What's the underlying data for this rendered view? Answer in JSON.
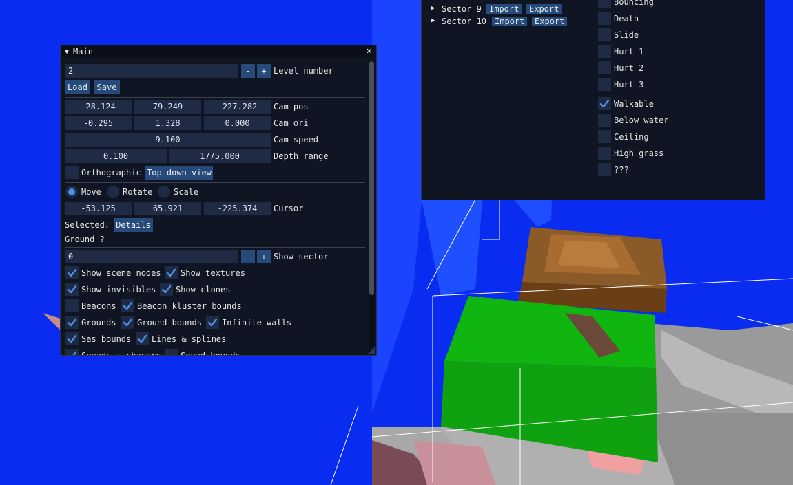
{
  "main_window": {
    "title": "Main",
    "level_number": "2",
    "level_label": "Level number",
    "minus": "-",
    "plus": "+",
    "load": "Load",
    "save": "Save",
    "cam_pos": [
      "-28.124",
      "79.249",
      "-227.282"
    ],
    "cam_pos_label": "Cam pos",
    "cam_ori": [
      "-0.295",
      "1.328",
      "0.000"
    ],
    "cam_ori_label": "Cam ori",
    "cam_speed": "9.100",
    "cam_speed_label": "Cam speed",
    "depth_range": [
      "0.100",
      "1775.000"
    ],
    "depth_range_label": "Depth range",
    "orthographic": "Orthographic",
    "top_down": "Top-down view",
    "move": "Move",
    "rotate": "Rotate",
    "scale": "Scale",
    "cursor": [
      "-53.125",
      "65.921",
      "-225.374"
    ],
    "cursor_label": "Cursor",
    "selected": "Selected:",
    "details": "Details",
    "ground": "Ground ?",
    "show_sector_value": "0",
    "show_sector_label": "Show sector",
    "show_scene_nodes": "Show scene nodes",
    "show_textures": "Show textures",
    "show_invisibles": "Show invisibles",
    "show_clones": "Show clones",
    "beacons": "Beacons",
    "beacon_kluster_bounds": "Beacon kluster bounds",
    "grounds": "Grounds",
    "ground_bounds": "Ground bounds",
    "infinite_walls": "Infinite walls",
    "sas_bounds": "Sas bounds",
    "lines_splines": "Lines & splines",
    "squads_chasers": "Squads + chasers",
    "squad_bounds": "Squad bounds"
  },
  "sectors_window": {
    "sector9": "Sector 9",
    "sector10": "Sector 10",
    "import": "Import",
    "export": "Export",
    "flags": [
      {
        "label": "Bouncing",
        "checked": false
      },
      {
        "label": "Death",
        "checked": false
      },
      {
        "label": "Slide",
        "checked": false
      },
      {
        "label": "Hurt 1",
        "checked": false
      },
      {
        "label": "Hurt 2",
        "checked": false
      },
      {
        "label": "Hurt 3",
        "checked": false
      },
      {
        "label": "Walkable",
        "checked": true
      },
      {
        "label": "Below water",
        "checked": false
      },
      {
        "label": "Ceiling",
        "checked": false
      },
      {
        "label": "High grass",
        "checked": false
      },
      {
        "label": "???",
        "checked": false
      }
    ]
  },
  "colors": {
    "sky": "#0a2cf0",
    "ground_green": "#12b012",
    "accent": "#4a90e8"
  }
}
